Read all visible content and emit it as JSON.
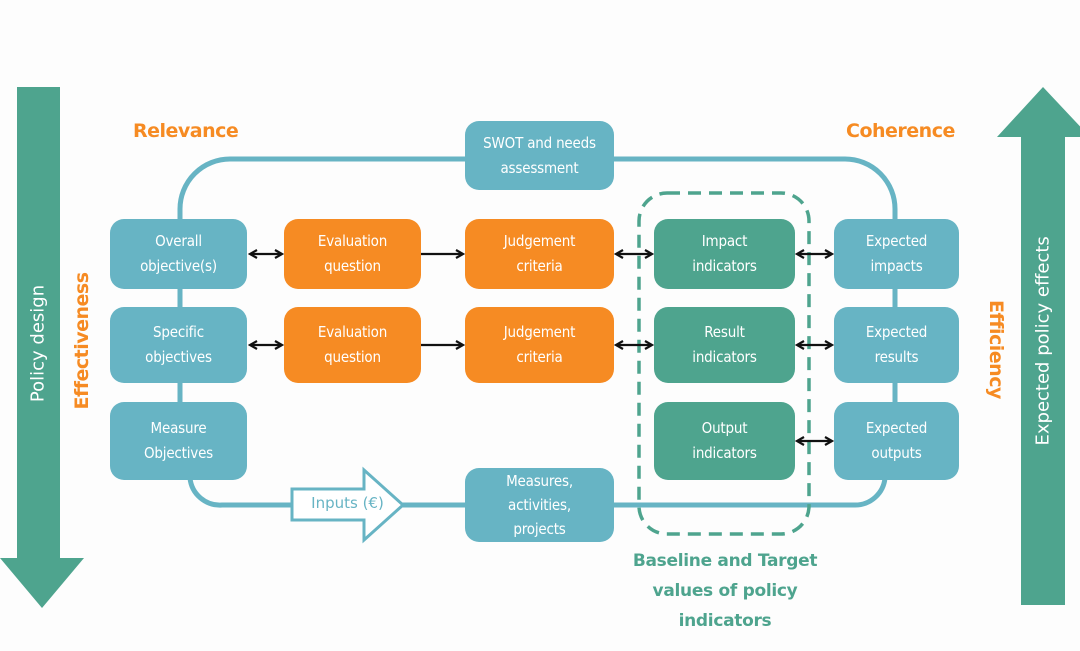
{
  "colors": {
    "teal_box": "#67b4c4",
    "orange_box": "#f68b23",
    "green_box": "#4ea48e",
    "criteria_label": "#f68b23",
    "side_arrow": "#4ea48e"
  },
  "side_arrows": {
    "left": {
      "label": "Policy design",
      "direction": "down"
    },
    "right": {
      "label": "Expected policy effects",
      "direction": "up"
    }
  },
  "criteria": {
    "relevance": "Relevance",
    "coherence": "Coherence",
    "effectiveness": "Effectiveness",
    "efficiency": "Efficiency"
  },
  "boxes": {
    "swot": "SWOT and needs\nassessment",
    "overall_objectives": "Overall\nobjective(s)",
    "specific_objectives": "Specific\nobjectives",
    "measure_objectives": "Measure\nObjectives",
    "eval_question_1": "Evaluation\nquestion",
    "eval_question_2": "Evaluation\nquestion",
    "judgement_criteria_1": "Judgement\ncriteria",
    "judgement_criteria_2": "Judgement\ncriteria",
    "impact_indicators": "Impact\nindicators",
    "result_indicators": "Result\nindicators",
    "output_indicators": "Output\nindicators",
    "expected_impacts": "Expected\nimpacts",
    "expected_results": "Expected\nresults",
    "expected_outputs": "Expected\noutputs",
    "measures": "Measures,\nactivities,\nprojects"
  },
  "inputs_arrow": "Inputs (€)",
  "indicator_group_caption": "Baseline and Target\nvalues of policy\nindicators"
}
